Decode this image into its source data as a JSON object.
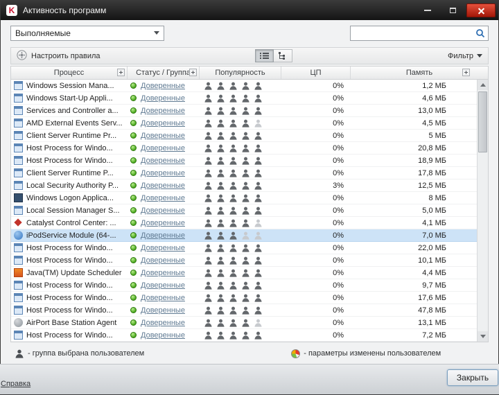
{
  "window": {
    "title": "Активность программ",
    "logo_letter": "K"
  },
  "filters": {
    "view_dropdown": {
      "value": "Выполняемые"
    },
    "search": {
      "value": ""
    }
  },
  "toolbar": {
    "configure_rules": "Настроить правила",
    "filter": "Фильтр"
  },
  "table": {
    "columns": [
      {
        "label": "Процесс",
        "expandable": true
      },
      {
        "label": "Статус / Группа",
        "expandable": true
      },
      {
        "label": "Популярность",
        "expandable": false
      },
      {
        "label": "ЦП",
        "expandable": false
      },
      {
        "label": "Память",
        "expandable": true
      }
    ],
    "status_color": "#44a317",
    "rows": [
      {
        "icon": "winapp",
        "name": "Windows Session Mana...",
        "status": "Доверенные",
        "popularity": 5,
        "cpu": "0%",
        "memory": "1,2 МБ",
        "selected": false
      },
      {
        "icon": "winapp",
        "name": "Windows Start-Up Appli...",
        "status": "Доверенные",
        "popularity": 5,
        "cpu": "0%",
        "memory": "4,6 МБ",
        "selected": false
      },
      {
        "icon": "winapp",
        "name": "Services and Controller a...",
        "status": "Доверенные",
        "popularity": 5,
        "cpu": "0%",
        "memory": "13,0 МБ",
        "selected": false
      },
      {
        "icon": "winapp",
        "name": "AMD External Events Serv...",
        "status": "Доверенные",
        "popularity": 4,
        "cpu": "0%",
        "memory": "4,5 МБ",
        "selected": false
      },
      {
        "icon": "winapp",
        "name": "Client Server Runtime Pr...",
        "status": "Доверенные",
        "popularity": 5,
        "cpu": "0%",
        "memory": "5 МБ",
        "selected": false
      },
      {
        "icon": "winapp",
        "name": "Host Process for Windo...",
        "status": "Доверенные",
        "popularity": 5,
        "cpu": "0%",
        "memory": "20,8 МБ",
        "selected": false
      },
      {
        "icon": "winapp",
        "name": "Host Process for Windo...",
        "status": "Доверенные",
        "popularity": 5,
        "cpu": "0%",
        "memory": "18,9 МБ",
        "selected": false
      },
      {
        "icon": "winapp",
        "name": "Client Server Runtime P...",
        "status": "Доверенные",
        "popularity": 5,
        "cpu": "0%",
        "memory": "17,8 МБ",
        "selected": false
      },
      {
        "icon": "winapp",
        "name": "Local Security Authority P...",
        "status": "Доверенные",
        "popularity": 5,
        "cpu": "3%",
        "memory": "12,5 МБ",
        "selected": false
      },
      {
        "icon": "logon",
        "name": "Windows Logon Applica...",
        "status": "Доверенные",
        "popularity": 5,
        "cpu": "0%",
        "memory": "8 МБ",
        "selected": false
      },
      {
        "icon": "winapp",
        "name": "Local Session Manager S...",
        "status": "Доверенные",
        "popularity": 5,
        "cpu": "0%",
        "memory": "5,0 МБ",
        "selected": false
      },
      {
        "icon": "catalyst",
        "name": "Catalyst Control Center: ...",
        "status": "Доверенные",
        "popularity": 4,
        "cpu": "0%",
        "memory": "4,1 МБ",
        "selected": false
      },
      {
        "icon": "ipod",
        "name": "iPodService Module (64-...",
        "status": "Доверенные",
        "popularity": 3,
        "cpu": "0%",
        "memory": "7,0 МБ",
        "selected": true
      },
      {
        "icon": "winapp",
        "name": "Host Process for Windo...",
        "status": "Доверенные",
        "popularity": 5,
        "cpu": "0%",
        "memory": "22,0 МБ",
        "selected": false
      },
      {
        "icon": "winapp",
        "name": "Host Process for Windo...",
        "status": "Доверенные",
        "popularity": 5,
        "cpu": "0%",
        "memory": "10,1 МБ",
        "selected": false
      },
      {
        "icon": "java",
        "name": "Java(TM) Update Scheduler",
        "status": "Доверенные",
        "popularity": 5,
        "cpu": "0%",
        "memory": "4,4 МБ",
        "selected": false
      },
      {
        "icon": "winapp",
        "name": "Host Process for Windo...",
        "status": "Доверенные",
        "popularity": 5,
        "cpu": "0%",
        "memory": "9,7 МБ",
        "selected": false
      },
      {
        "icon": "winapp",
        "name": "Host Process for Windo...",
        "status": "Доверенные",
        "popularity": 5,
        "cpu": "0%",
        "memory": "17,6 МБ",
        "selected": false
      },
      {
        "icon": "winapp",
        "name": "Host Process for Windo...",
        "status": "Доверенные",
        "popularity": 5,
        "cpu": "0%",
        "memory": "47,8 МБ",
        "selected": false
      },
      {
        "icon": "airport",
        "name": "AirPort Base Station Agent",
        "status": "Доверенные",
        "popularity": 4,
        "cpu": "0%",
        "memory": "13,1 МБ",
        "selected": false
      },
      {
        "icon": "winapp",
        "name": "Host Process for Windo...",
        "status": "Доверенные",
        "popularity": 5,
        "cpu": "0%",
        "memory": "7,2 МБ",
        "selected": false
      }
    ]
  },
  "legend": [
    {
      "icon": "user-icon",
      "text": "- группа выбрана пользователем"
    },
    {
      "icon": "kaspersky-sphere-icon",
      "text": "- параметры изменены пользователем"
    }
  ],
  "footer": {
    "help": "Справка",
    "close": "Закрыть"
  }
}
